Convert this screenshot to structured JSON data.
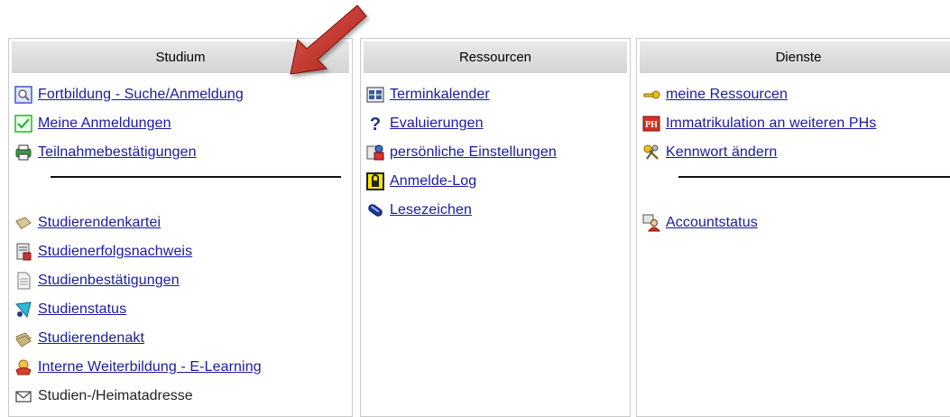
{
  "studium": {
    "title": "Studium",
    "group1": [
      {
        "label": "Fortbildung - Suche/Anmeldung",
        "icon": "magnifier-window-icon"
      },
      {
        "label": "Meine Anmeldungen",
        "icon": "checkmark-icon"
      },
      {
        "label": "Teilnahmebestätigungen",
        "icon": "printer-icon"
      }
    ],
    "group2": [
      {
        "label": "Studierendenkartei",
        "icon": "card-file-icon"
      },
      {
        "label": "Studienerfolgsnachweis",
        "icon": "report-icon"
      },
      {
        "label": "Studienbestätigungen",
        "icon": "document-icon"
      },
      {
        "label": "Studienstatus",
        "icon": "status-icon"
      },
      {
        "label": "Studierendenakt",
        "icon": "folder-file-icon"
      },
      {
        "label": "Interne Weiterbildung - E-Learning",
        "icon": "learning-icon"
      },
      {
        "label": "Studien-/Heimatadresse",
        "icon": "envelope-icon"
      }
    ]
  },
  "ressourcen": {
    "title": "Ressourcen",
    "items": [
      {
        "label": "Terminkalender",
        "icon": "calendar-icon"
      },
      {
        "label": "Evaluierungen",
        "icon": "question-icon"
      },
      {
        "label": "persönliche Einstellungen",
        "icon": "settings-icon"
      },
      {
        "label": "Anmelde-Log",
        "icon": "lock-icon"
      },
      {
        "label": "Lesezeichen",
        "icon": "bookmark-icon"
      }
    ]
  },
  "dienste": {
    "title": "Dienste",
    "group1": [
      {
        "label": "meine Ressourcen",
        "icon": "key-icon"
      },
      {
        "label": "Immatrikulation an weiteren PHs",
        "icon": "ph-icon"
      },
      {
        "label": "Kennwort ändern",
        "icon": "keys-icon"
      }
    ],
    "group2": [
      {
        "label": "Accountstatus",
        "icon": "user-account-icon"
      }
    ]
  },
  "colors": {
    "link": "#1a1aa0",
    "header_bg": "#dcdcdc",
    "arrow": "#c8312b"
  }
}
